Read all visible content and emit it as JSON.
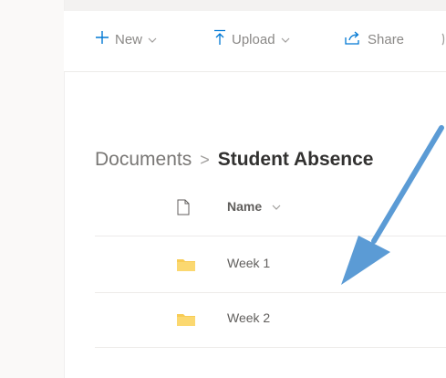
{
  "command_bar": {
    "new_label": "New",
    "upload_label": "Upload",
    "share_label": "Share"
  },
  "breadcrumb": {
    "root": "Documents",
    "separator": ">",
    "current": "Student Absence"
  },
  "list": {
    "header_name": "Name",
    "items": [
      {
        "name": "Week 1",
        "icon": "folder-icon"
      },
      {
        "name": "Week 2",
        "icon": "folder-icon"
      }
    ]
  },
  "colors": {
    "accent": "#0078d4",
    "folder": "#f8cc55",
    "arrow": "#5b9bd5"
  }
}
